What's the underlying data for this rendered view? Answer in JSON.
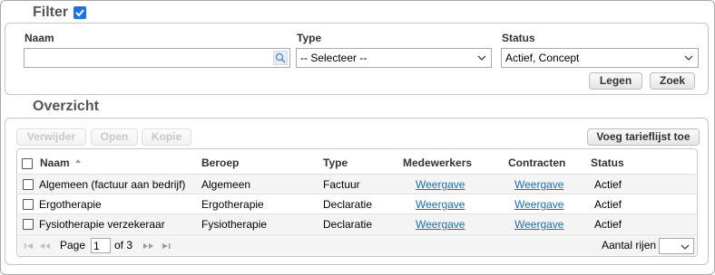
{
  "filter": {
    "title": "Filter",
    "enabled": true,
    "naam_label": "Naam",
    "naam_value": "",
    "type_label": "Type",
    "type_selected": "-- Selecteer --",
    "status_label": "Status",
    "status_selected": "Actief, Concept",
    "clear_button": "Legen",
    "search_button": "Zoek"
  },
  "overview": {
    "title": "Overzicht",
    "toolbar": {
      "delete": "Verwijder",
      "open": "Open",
      "copy": "Kopie",
      "add": "Voeg tarieflijst toe"
    },
    "columns": [
      "Naam",
      "Beroep",
      "Type",
      "Medewerkers",
      "Contracten",
      "Status"
    ],
    "rows": [
      {
        "naam": "Algemeen (factuur aan bedrijf)",
        "beroep": "Algemeen",
        "type": "Factuur",
        "medewerkers": "Weergave",
        "contracten": "Weergave",
        "status": "Actief"
      },
      {
        "naam": "Ergotherapie",
        "beroep": "Ergotherapie",
        "type": "Declaratie",
        "medewerkers": "Weergave",
        "contracten": "Weergave",
        "status": "Actief"
      },
      {
        "naam": "Fysiotherapie verzekeraar",
        "beroep": "Fysiotherapie",
        "type": "Declaratie",
        "medewerkers": "Weergave",
        "contracten": "Weergave",
        "status": "Actief"
      }
    ],
    "pager": {
      "page_label": "Page",
      "page_value": "1",
      "of_label": "of 3",
      "rows_label": "Aantal rijen",
      "rows_value": ""
    }
  },
  "colors": {
    "link": "#1c6fb5",
    "checkbox": "#1a73e8"
  }
}
